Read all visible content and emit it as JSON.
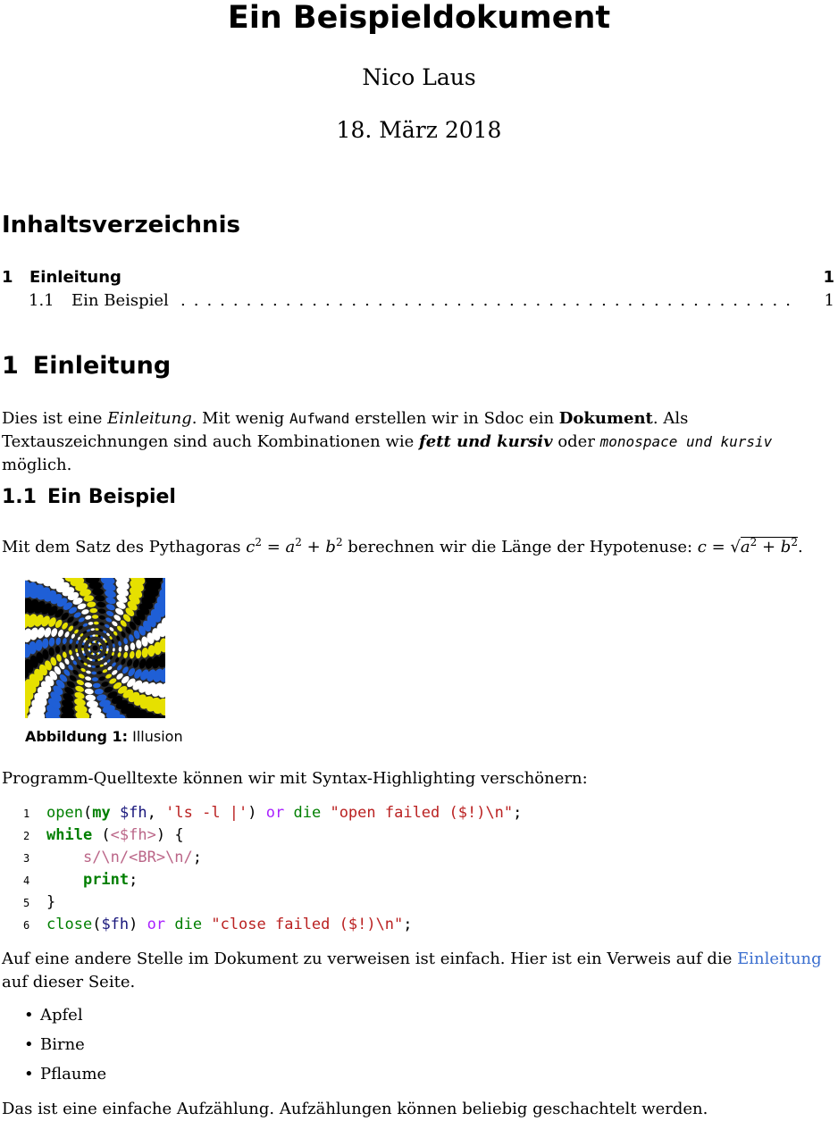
{
  "header": {
    "title": "Ein Beispieldokument",
    "author": "Nico Laus",
    "date": "18. März 2018"
  },
  "toc": {
    "heading": "Inhaltsverzeichnis",
    "entries": [
      {
        "num": "1",
        "label": "Einleitung",
        "page": "1"
      },
      {
        "num": "1.1",
        "label": "Ein Beispiel",
        "page": "1"
      }
    ]
  },
  "section1": {
    "num": "1",
    "title": "Einleitung",
    "p1": {
      "a": "Dies ist eine ",
      "italic": "Einleitung",
      "b": ". Mit wenig ",
      "mono": "Aufwand",
      "c": " erstellen wir in Sdoc ein ",
      "bold": "Dokument",
      "d": ". Als Textauszeichnungen sind auch Kombinationen wie ",
      "bold_italic": "fett und kursiv",
      "e": " oder ",
      "mono_italic": "monospace und kursiv",
      "f": " möglich."
    }
  },
  "section11": {
    "num": "1.1",
    "title": "Ein Beispiel",
    "p2_a": "Mit dem Satz des Pythagoras ",
    "p2_b": " berechnen wir die Länge der Hypotenuse: ",
    "p2_c": ".",
    "figure_label": "Abbildung 1:",
    "figure_caption": "Illusion",
    "p3": "Programm-Quelltexte können wir mit Syntax-Highlighting verschönern:",
    "p4_a": "Auf eine andere Stelle im Dokument zu verweisen ist einfach. Hier ist ein Verweis auf die ",
    "p4_link": "Einleitung",
    "p4_b": " auf dieser Seite.",
    "list": [
      "Apfel",
      "Birne",
      "Pflaume"
    ],
    "p5": "Das ist eine einfache Aufzählung. Aufzählungen können beliebig geschachtelt werden."
  },
  "code": {
    "line_numbers": [
      "1",
      "2",
      "3",
      "4",
      "5",
      "6"
    ],
    "l1": [
      "open",
      "(",
      "my",
      " ",
      "$fh",
      ", ",
      "'ls -l |'",
      ") ",
      "or",
      " ",
      "die",
      " ",
      "\"open failed ($!)\\n\"",
      ";"
    ],
    "l2": [
      "while",
      " (",
      "<$fh>",
      ") {"
    ],
    "l3": [
      "    ",
      "s/\\n/<BR>\\n/",
      ";"
    ],
    "l4": [
      "    ",
      "print",
      ";"
    ],
    "l5": [
      "}"
    ],
    "l6": [
      "close",
      "(",
      "$fh",
      ") ",
      "or",
      " ",
      "die",
      " ",
      "\"close failed ($!)\\n\"",
      ";"
    ]
  },
  "colors": {
    "link": "#3a6ecf",
    "keyword": "#007f00",
    "string": "#ba2121",
    "variable": "#19177c",
    "operator": "#aa22ff",
    "regex": "#bb6688",
    "illusion_blue": "#1f5fd6",
    "illusion_yellow": "#e6e000",
    "illusion_black": "#000000",
    "illusion_white": "#ffffff"
  }
}
